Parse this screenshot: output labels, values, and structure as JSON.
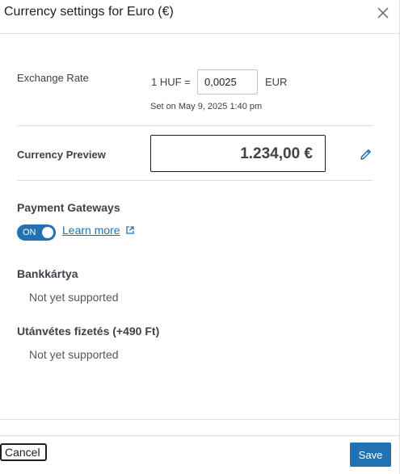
{
  "dialog": {
    "title": "Currency settings for Euro (€)",
    "close_icon": "close-icon"
  },
  "exchange_rate": {
    "label": "Exchange Rate",
    "prefix": "1 HUF =",
    "value": "0,0025",
    "suffix": "EUR",
    "set_on": "Set on May 9, 2025 1:40 pm"
  },
  "currency_preview": {
    "label": "Currency Preview",
    "value": "1.234,00 €",
    "edit_icon": "pencil-icon"
  },
  "payment_gateways": {
    "title": "Payment Gateways",
    "toggle_label": "ON",
    "toggle_state": "on",
    "learn_more": "Learn more",
    "external_icon": "external-link-icon",
    "gateways": [
      {
        "name": "Bankkártya",
        "status": "Not yet supported"
      },
      {
        "name": "Utánvétes fizetés (+490 Ft)",
        "status": "Not yet supported"
      }
    ]
  },
  "footer": {
    "cancel_label": "Cancel",
    "save_label": "Save"
  },
  "colors": {
    "accent": "#2271b1",
    "text": "#3c434a",
    "border": "#dcdcde"
  }
}
